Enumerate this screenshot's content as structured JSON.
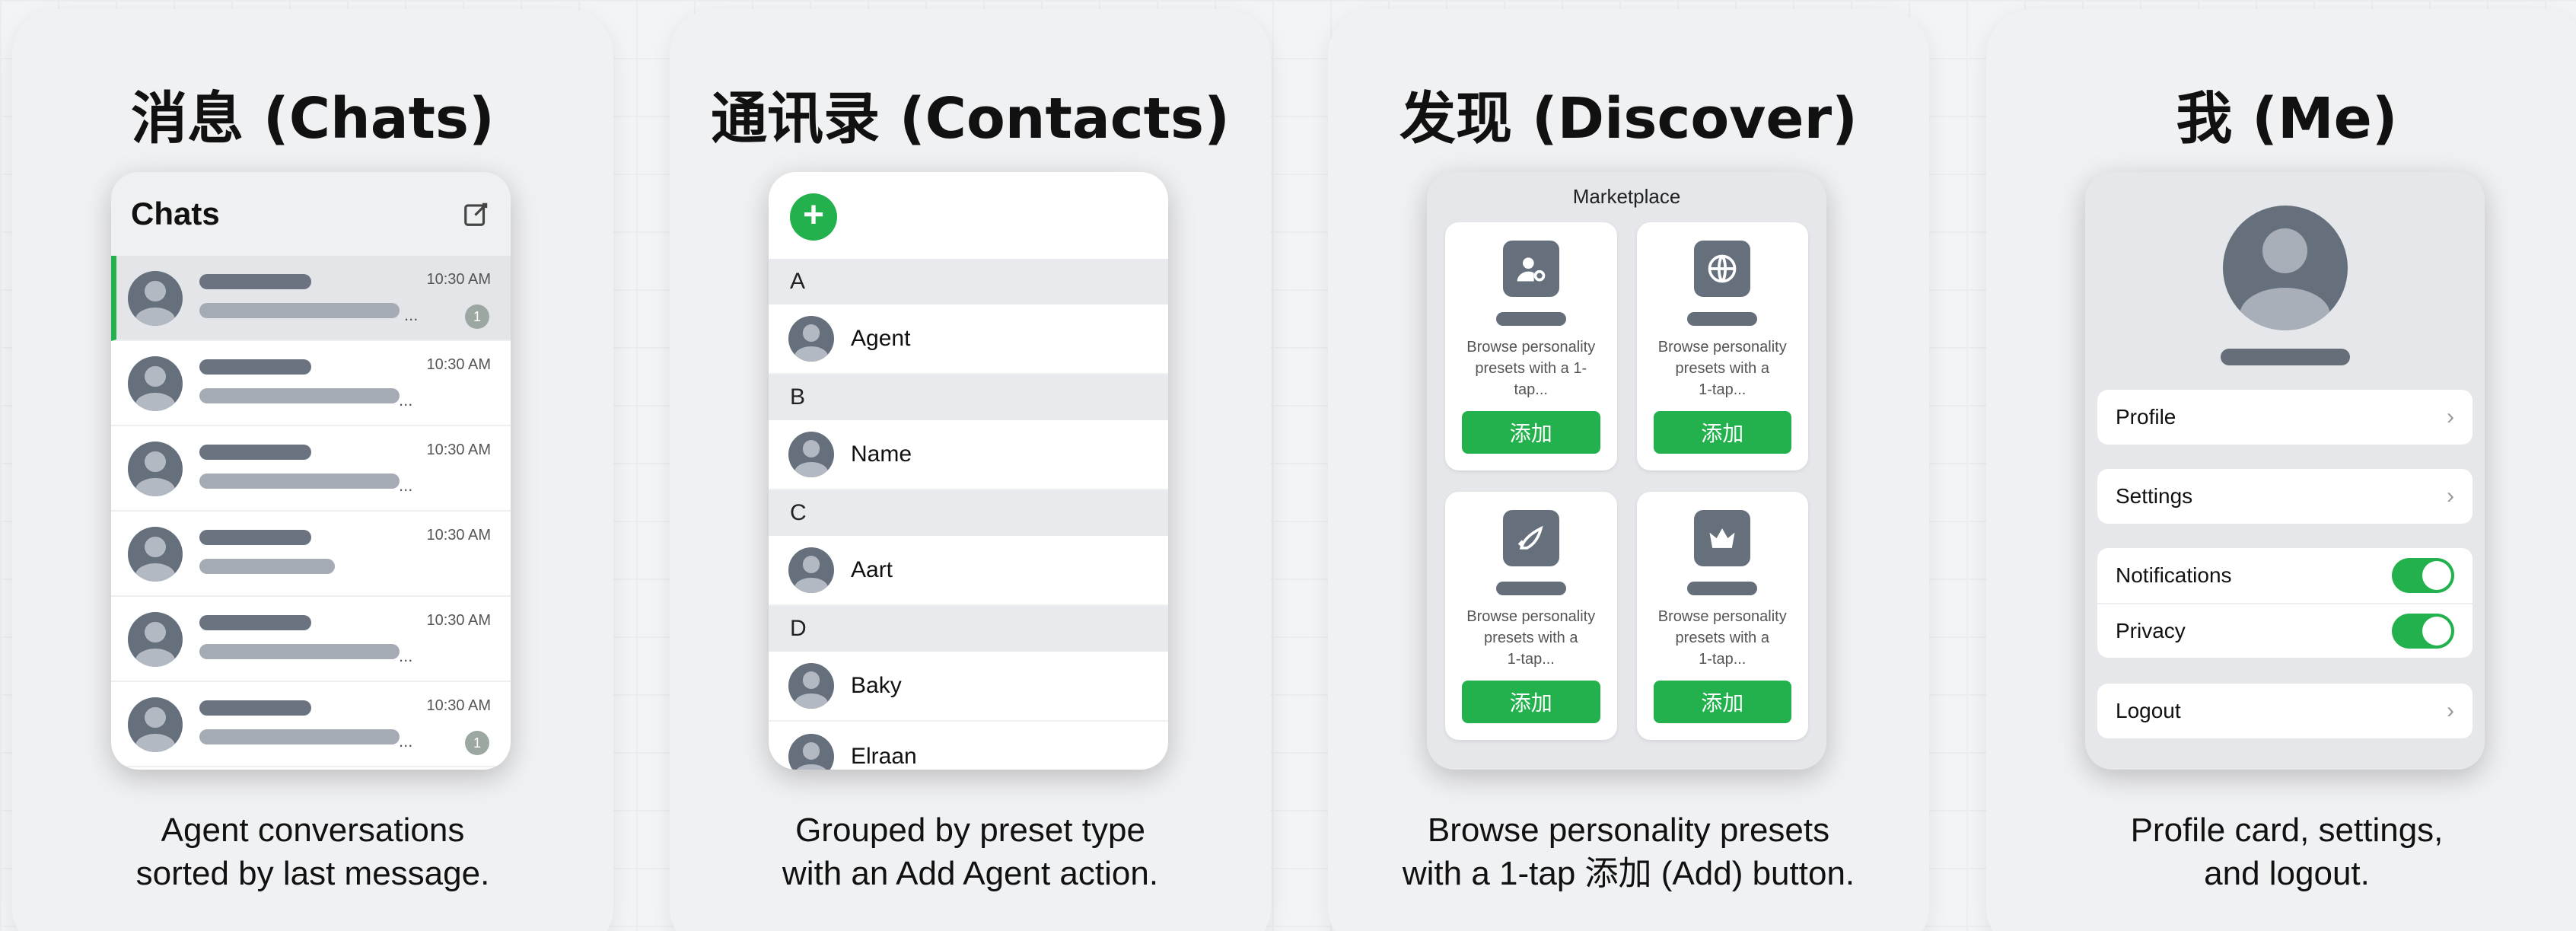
{
  "panels": {
    "chats": {
      "title": "消息 (Chats)",
      "header_title": "Chats",
      "caption": [
        "Agent conversations",
        "sorted by last message."
      ],
      "rows": [
        {
          "time": "10:30 AM",
          "badge": "1",
          "ellipsis": "...",
          "name_w": 142,
          "msg_w": 250
        },
        {
          "time": "10:30 AM",
          "badge": "",
          "ellipsis": "...",
          "name_w": 142,
          "msg_w": 250
        },
        {
          "time": "10:30 AM",
          "badge": "",
          "ellipsis": "...",
          "name_w": 116,
          "msg_w": 250
        },
        {
          "time": "10:30 AM",
          "badge": "",
          "ellipsis": "",
          "name_w": 116,
          "msg_w": 166
        },
        {
          "time": "10:30 AM",
          "badge": "",
          "ellipsis": "...",
          "name_w": 142,
          "msg_w": 250
        },
        {
          "time": "10:30 AM",
          "badge": "1",
          "ellipsis": "...",
          "name_w": 116,
          "msg_w": 250
        }
      ]
    },
    "contacts": {
      "title": "通讯录 (Contacts)",
      "add_symbol": "+",
      "caption": [
        "Grouped by preset type",
        "with an Add Agent action."
      ],
      "sections": [
        {
          "letter": "A",
          "name": "Agent"
        },
        {
          "letter": "B",
          "name": "Name"
        },
        {
          "letter": "C",
          "name": "Aart"
        },
        {
          "letter": "D",
          "name": "Baky"
        }
      ],
      "partial_name": "Elraan"
    },
    "discover": {
      "title": "发现 (Discover)",
      "marketplace": "Marketplace",
      "caption": [
        "Browse personality presets",
        "with a 1-tap 添加 (Add) button."
      ],
      "cards": [
        {
          "icon": "user-settings-icon",
          "desc": [
            "Browse personality",
            "presets with a 1-",
            "tap..."
          ],
          "button": "添加"
        },
        {
          "icon": "globe-icon",
          "desc": [
            "Browse personality",
            "presets with a",
            "1-tap..."
          ],
          "button": "添加"
        },
        {
          "icon": "rocket-icon",
          "desc": [
            "Browse personality",
            "presets with a",
            "1-tap..."
          ],
          "button": "添加"
        },
        {
          "icon": "crown-icon",
          "desc": [
            "Browse personality",
            "presets with a",
            "1-tap..."
          ],
          "button": "添加"
        }
      ]
    },
    "me": {
      "title": "我 (Me)",
      "caption": [
        "Profile card, settings,",
        "and logout."
      ],
      "profile": "Profile",
      "settings": "Settings",
      "notifications": "Notifications",
      "privacy": "Privacy",
      "logout": "Logout",
      "chevron": "›"
    }
  },
  "colors": {
    "accent_green": "#22b14c",
    "avatar_gray": "#666f7c"
  }
}
